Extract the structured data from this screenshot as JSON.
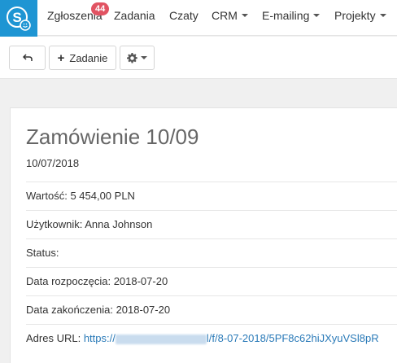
{
  "nav": {
    "items": [
      {
        "label": "Zgłoszenia",
        "badge": "44"
      },
      {
        "label": "Zadania"
      },
      {
        "label": "Czaty"
      },
      {
        "label": "CRM"
      },
      {
        "label": "E-mailing"
      },
      {
        "label": "Projekty"
      }
    ]
  },
  "toolbar": {
    "back_icon": "back-arrow-icon",
    "add_label": "Zadanie",
    "settings_icon": "gear-icon"
  },
  "record": {
    "title": "Zamówienie 10/09",
    "date": "10/07/2018",
    "fields": [
      {
        "label": "Wartość:",
        "value": "5 454,00 PLN"
      },
      {
        "label": "Użytkownik:",
        "value": "Anna Johnson"
      },
      {
        "label": "Status:",
        "value": ""
      },
      {
        "label": "Data rozpoczęcia:",
        "value": "2018-07-20"
      },
      {
        "label": "Data zakończenia:",
        "value": "2018-07-20"
      }
    ],
    "url": {
      "label": "Adres URL:",
      "prefix": "https://",
      "suffix": "l/f/8-07-2018/5PF8c62hiJXyuVSl8pR"
    }
  }
}
